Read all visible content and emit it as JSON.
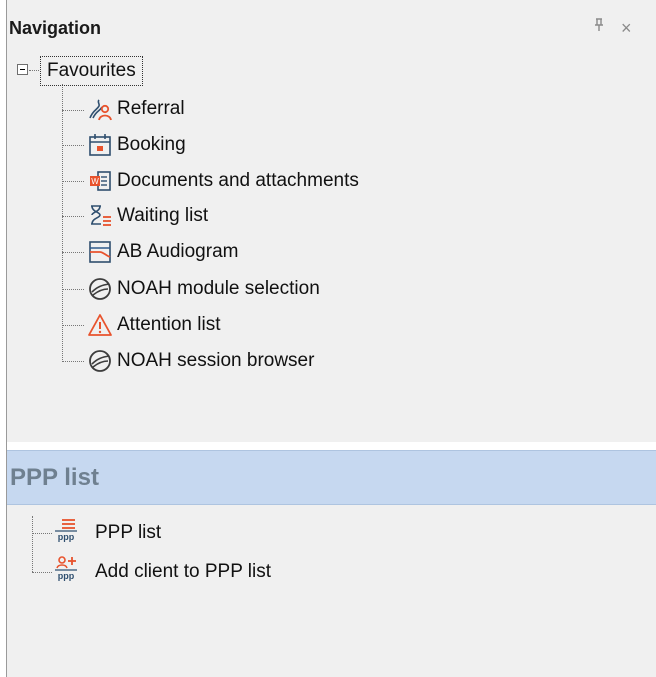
{
  "navigation": {
    "title": "Navigation",
    "pin_glyph": "ᵖ",
    "close_glyph": "×",
    "favourites": {
      "label": "Favourites",
      "items": [
        {
          "label": "Referral",
          "icon": "referral-icon"
        },
        {
          "label": "Booking",
          "icon": "booking-calendar-icon"
        },
        {
          "label": "Documents and attachments",
          "icon": "documents-icon"
        },
        {
          "label": "Waiting list",
          "icon": "waiting-list-icon"
        },
        {
          "label": "AB Audiogram",
          "icon": "audiogram-icon"
        },
        {
          "label": "NOAH module selection",
          "icon": "noah-icon"
        },
        {
          "label": "Attention list",
          "icon": "warning-triangle-icon"
        },
        {
          "label": "NOAH session browser",
          "icon": "noah-icon"
        }
      ]
    }
  },
  "ppp": {
    "title": "PPP list",
    "items": [
      {
        "label": "PPP list",
        "icon": "ppp-list-icon"
      },
      {
        "label": "Add client to PPP list",
        "icon": "add-client-ppp-icon"
      }
    ]
  },
  "colors": {
    "accent_orange": "#e8532d",
    "accent_blue": "#2f5a8c",
    "ppp_header_bg": "#c6d8f0"
  }
}
